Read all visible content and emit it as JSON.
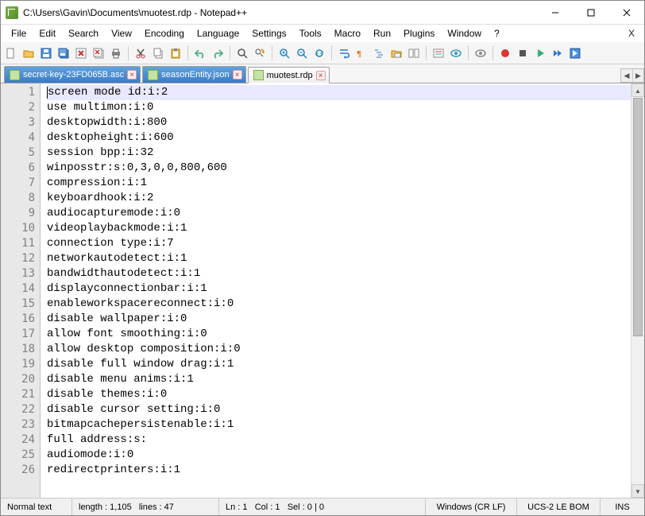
{
  "window": {
    "title": "C:\\Users\\Gavin\\Documents\\muotest.rdp - Notepad++"
  },
  "menu": {
    "items": [
      "File",
      "Edit",
      "Search",
      "View",
      "Encoding",
      "Language",
      "Settings",
      "Tools",
      "Macro",
      "Run",
      "Plugins",
      "Window",
      "?"
    ],
    "doc_switch": "X"
  },
  "toolbar_icons": [
    "new-file",
    "open-file",
    "save",
    "save-all",
    "close",
    "close-all",
    "print",
    "|",
    "cut",
    "copy",
    "paste",
    "|",
    "undo",
    "redo",
    "|",
    "find",
    "replace",
    "|",
    "zoom-in",
    "zoom-out",
    "sync",
    "|",
    "word-wrap",
    "show-all",
    "indent-guide",
    "folder",
    "doc-switcher",
    "|",
    "function-list",
    "doc-map",
    "|",
    "monitor",
    "|",
    "record-macro",
    "stop-macro",
    "play-macro",
    "fast-play",
    "save-macro"
  ],
  "tabs": [
    {
      "label": "secret-key-23FD065B.asc",
      "active": false
    },
    {
      "label": "seasonEntity.json",
      "active": false
    },
    {
      "label": "muotest.rdp",
      "active": true
    }
  ],
  "code_lines": [
    "screen mode id:i:2",
    "use multimon:i:0",
    "desktopwidth:i:800",
    "desktopheight:i:600",
    "session bpp:i:32",
    "winposstr:s:0,3,0,0,800,600",
    "compression:i:1",
    "keyboardhook:i:2",
    "audiocapturemode:i:0",
    "videoplaybackmode:i:1",
    "connection type:i:7",
    "networkautodetect:i:1",
    "bandwidthautodetect:i:1",
    "displayconnectionbar:i:1",
    "enableworkspacereconnect:i:0",
    "disable wallpaper:i:0",
    "allow font smoothing:i:0",
    "allow desktop composition:i:0",
    "disable full window drag:i:1",
    "disable menu anims:i:1",
    "disable themes:i:0",
    "disable cursor setting:i:0",
    "bitmapcachepersistenable:i:1",
    "full address:s:",
    "audiomode:i:0",
    "redirectprinters:i:1"
  ],
  "status": {
    "lang": "Normal text",
    "length_label": "length :",
    "length": "1,105",
    "lines_label": "lines :",
    "lines": "47",
    "ln_label": "Ln :",
    "ln": "1",
    "col_label": "Col :",
    "col": "1",
    "sel_label": "Sel :",
    "sel": "0 | 0",
    "eol": "Windows (CR LF)",
    "encoding": "UCS-2 LE BOM",
    "ins": "INS"
  }
}
